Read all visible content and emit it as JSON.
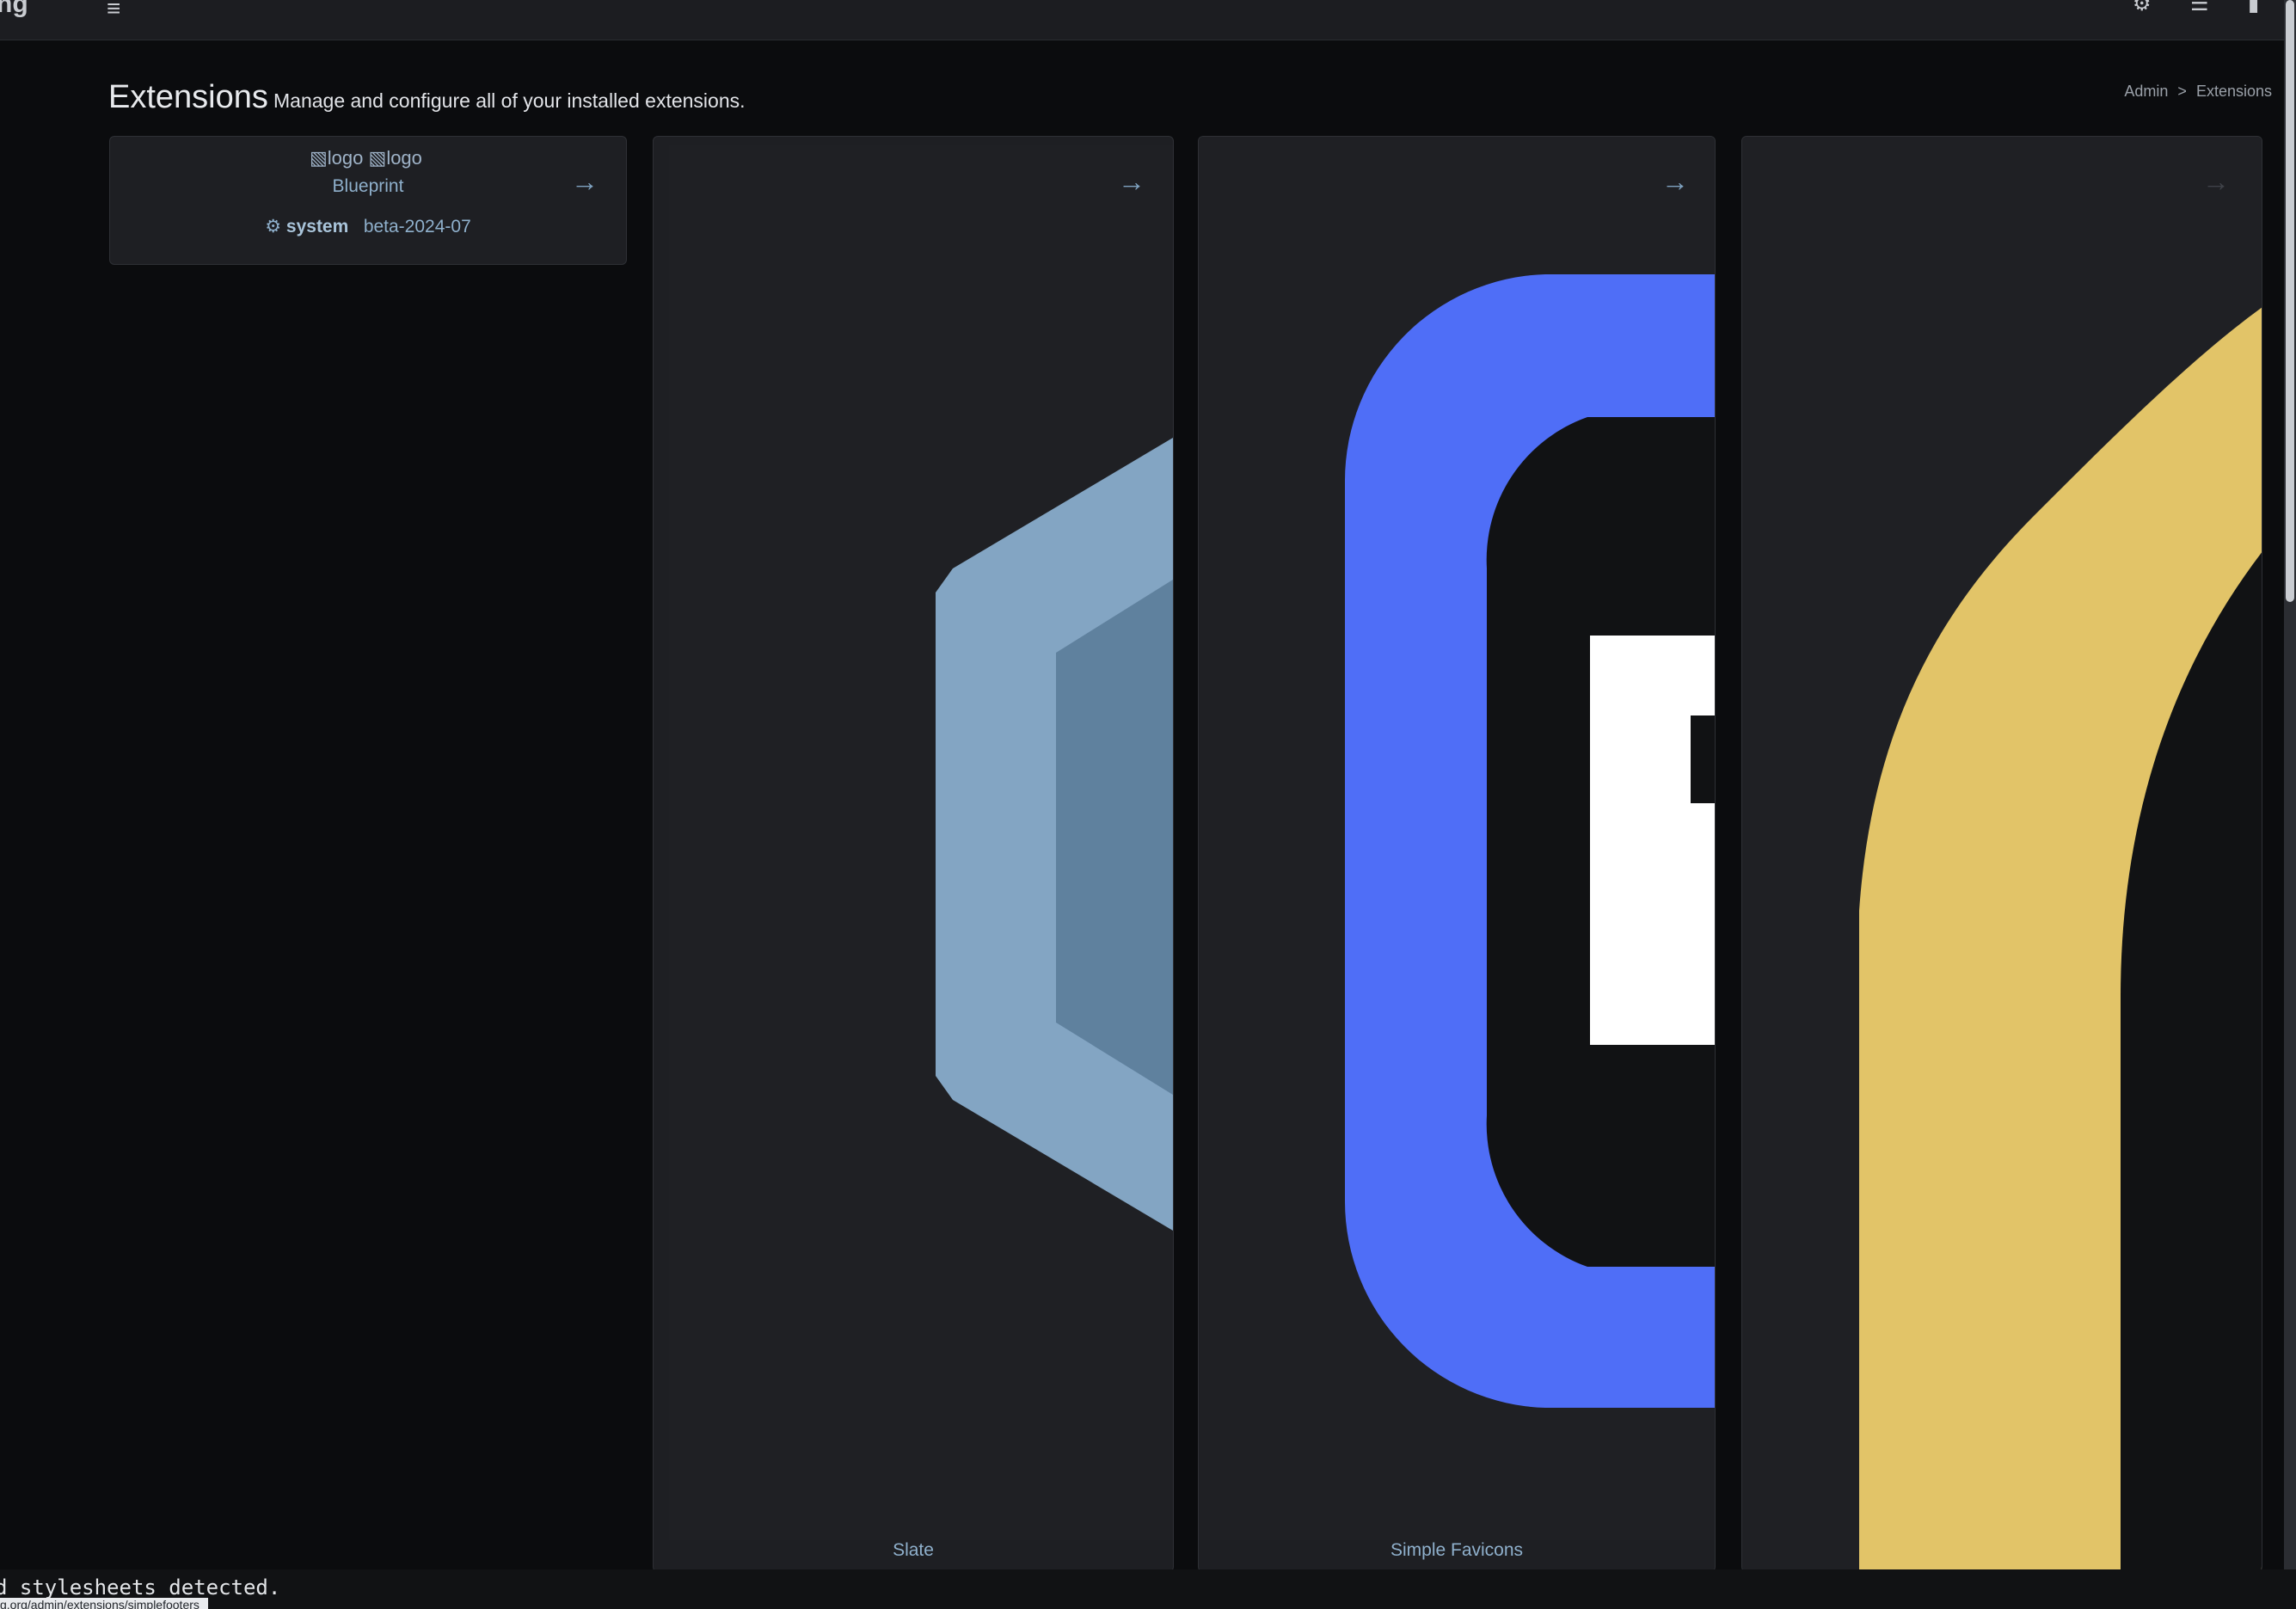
{
  "app": {
    "brand_text": "ng",
    "menu_icon": "hamburger-icon"
  },
  "topbar": {
    "icons": [
      "puzzle-icon",
      "database-icon",
      "user-icon"
    ]
  },
  "header": {
    "title": "Extensions",
    "subtitle": "Manage and configure all of your installed extensions."
  },
  "breadcrumb": {
    "items": [
      "Admin",
      "Extensions"
    ],
    "separator": ">"
  },
  "extensions": [
    {
      "name": "Blueprint",
      "logo_alt": "logo",
      "author": "system",
      "version": "beta-2024-07",
      "logo_kind": "broken-image"
    },
    {
      "name": "Slate",
      "logo_kind": "hexagon",
      "logo_colors": [
        "#83a5c3",
        "#5f819e"
      ]
    },
    {
      "name": "Simple Favicons",
      "logo_kind": "favicon-f",
      "logo_colors": [
        "#4f6ef7",
        "#111214",
        "#ffffff"
      ]
    },
    {
      "name": "",
      "logo_kind": "arch",
      "logo_colors": [
        "#e2c468",
        "#111214"
      ]
    }
  ],
  "status": {
    "message": "d stylesheets detected.",
    "url": "g.org/admin/extensions/simplefooters"
  }
}
